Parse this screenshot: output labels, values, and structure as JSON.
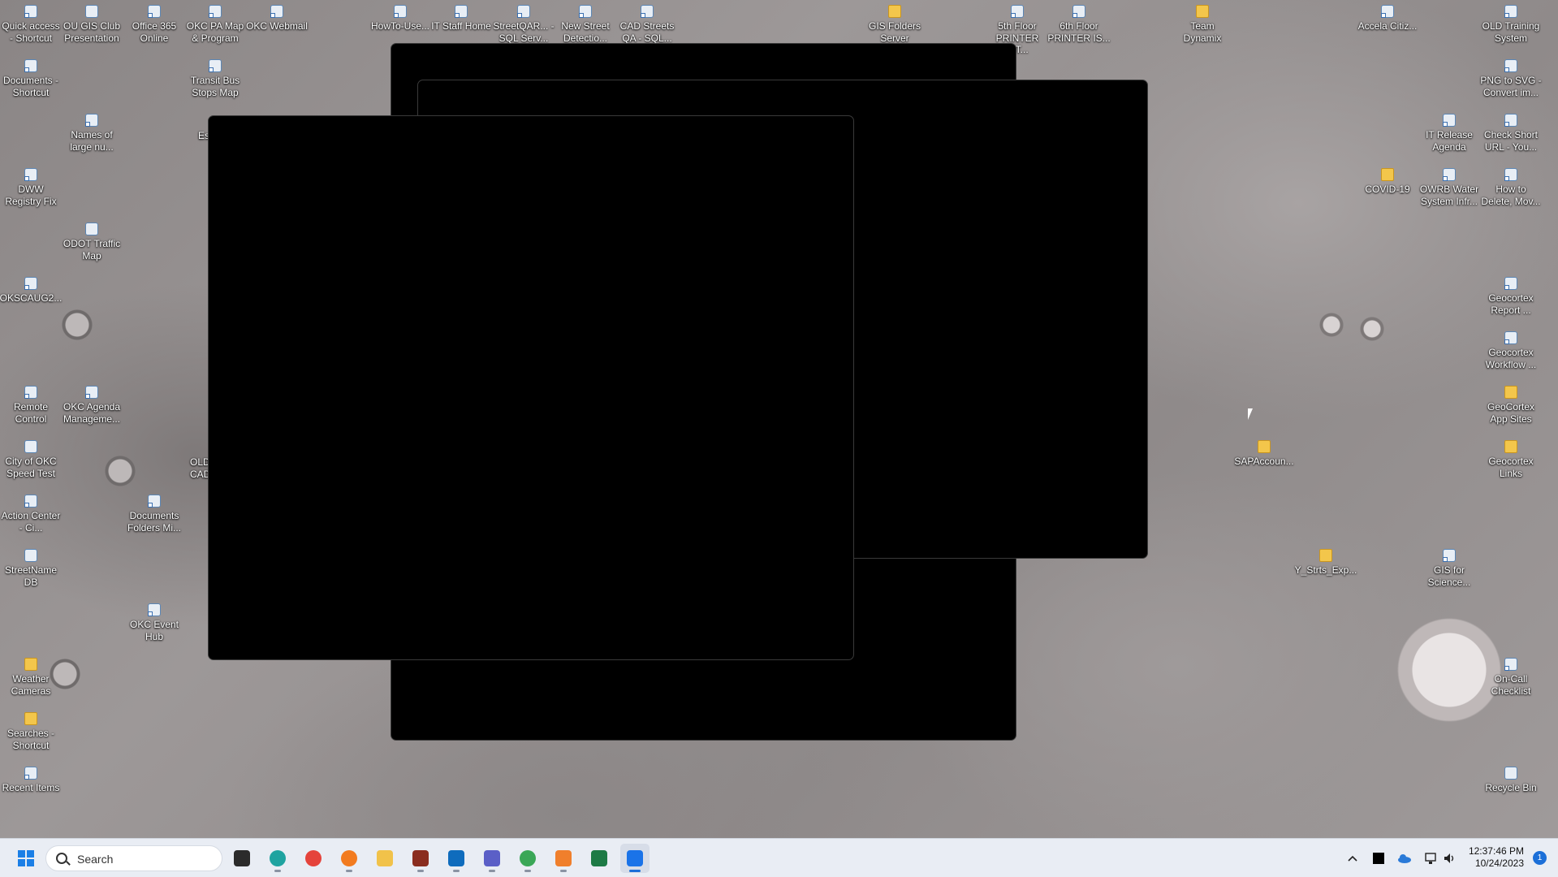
{
  "desktop": {
    "icons": [
      {
        "id": "quick-access",
        "label": "Quick access - Shortcut",
        "type": "link"
      },
      {
        "id": "ou-gis-club",
        "label": "OU GIS Club Presentation",
        "type": "doc"
      },
      {
        "id": "office-365",
        "label": "Office 365 Online",
        "type": "link"
      },
      {
        "id": "okc-pa-map",
        "label": "OKC PA Map & Program",
        "type": "link"
      },
      {
        "id": "okc-webmail",
        "label": "OKC Webmail",
        "type": "link"
      },
      {
        "id": "howto-use",
        "label": "HowTo-Use...",
        "type": "link"
      },
      {
        "id": "it-staff-home",
        "label": "IT Staff Home",
        "type": "link"
      },
      {
        "id": "streetqar",
        "label": "StreetQAR... - SQL Serv...",
        "type": "link"
      },
      {
        "id": "new-street",
        "label": "New Street Detectio...",
        "type": "link"
      },
      {
        "id": "cad-streets",
        "label": "CAD Streets QA - SQL...",
        "type": "link"
      },
      {
        "id": "gis-folders-server",
        "label": "GIS Folders Server",
        "type": "folder"
      },
      {
        "id": "5th-floor-printer",
        "label": "5th Floor PRINTER IST...",
        "type": "link"
      },
      {
        "id": "6th-floor-printer",
        "label": "6th Floor PRINTER IS...",
        "type": "link"
      },
      {
        "id": "team-dynamix",
        "label": "Team Dynamix",
        "type": "folder"
      },
      {
        "id": "accela",
        "label": "Accela Citiz...",
        "type": "link"
      },
      {
        "id": "old-training",
        "label": "OLD Training System",
        "type": "link"
      },
      {
        "id": "documents-shortcut",
        "label": "Documents - Shortcut",
        "type": "link"
      },
      {
        "id": "transit-bus",
        "label": "Transit Bus Stops Map",
        "type": "link"
      },
      {
        "id": "png-to-svg",
        "label": "PNG to SVG - Convert im...",
        "type": "link"
      },
      {
        "id": "names-large",
        "label": "Names of large nu...",
        "type": "link"
      },
      {
        "id": "it-release",
        "label": "IT Release Agenda",
        "type": "link"
      },
      {
        "id": "check-short-url",
        "label": "Check Short URL - You...",
        "type": "link"
      },
      {
        "id": "dww-registry",
        "label": "DWW Registry Fix",
        "type": "link"
      },
      {
        "id": "covid-19",
        "label": "COVID-19",
        "type": "folder"
      },
      {
        "id": "owrb-water",
        "label": "OWRB Water System Infr...",
        "type": "link"
      },
      {
        "id": "how-to-delete",
        "label": "How to Delete, Mov...",
        "type": "link"
      },
      {
        "id": "odot-traffic",
        "label": "ODOT Traffic Map",
        "type": "doc"
      },
      {
        "id": "okscaug",
        "label": "OKSCAUG2...",
        "type": "link"
      },
      {
        "id": "geocortex-report",
        "label": "Geocortex Report ...",
        "type": "link"
      },
      {
        "id": "geocortex-workflow",
        "label": "Geocortex Workflow ...",
        "type": "link"
      },
      {
        "id": "remote-control",
        "label": "Remote Control",
        "type": "link"
      },
      {
        "id": "okc-agenda",
        "label": "OKC Agenda Manageme...",
        "type": "link"
      },
      {
        "id": "geocortex-app-sites",
        "label": "GeoCortex App Sites",
        "type": "folder"
      },
      {
        "id": "sapaccoun",
        "label": "SAPAccoun...",
        "type": "folder"
      },
      {
        "id": "geocortex-links",
        "label": "Geocortex Links",
        "type": "folder"
      },
      {
        "id": "city-okc-speed",
        "label": "City of OKC Speed Test",
        "type": "doc"
      },
      {
        "id": "old-cad",
        "label": "OLD CAD",
        "type": "link"
      },
      {
        "id": "action-center",
        "label": "Action Center - Ci...",
        "type": "link"
      },
      {
        "id": "documents-folders",
        "label": "Documents Folders Mi...",
        "type": "link"
      },
      {
        "id": "streetname-db",
        "label": "StreetName DB",
        "type": "doc"
      },
      {
        "id": "y-strts-exp",
        "label": "Y_Strts_Exp...",
        "type": "folder"
      },
      {
        "id": "gis-for-science",
        "label": "GIS for Science...",
        "type": "link"
      },
      {
        "id": "okc-event-hub",
        "label": "OKC Event Hub",
        "type": "link"
      },
      {
        "id": "weather-cameras",
        "label": "Weather Cameras",
        "type": "folder"
      },
      {
        "id": "on-call-checklist",
        "label": "On-Call Checklist",
        "type": "link"
      },
      {
        "id": "searches-shortcut",
        "label": "Searches - Shortcut",
        "type": "folder"
      },
      {
        "id": "recent-items",
        "label": "Recent Items",
        "type": "link"
      },
      {
        "id": "recycle-bin",
        "label": "Recycle Bin",
        "type": "doc"
      },
      {
        "id": "partial-es",
        "label": "Es",
        "type": "link"
      }
    ]
  },
  "taskbar": {
    "search_placeholder": "Search",
    "apps": [
      {
        "name": "task-view",
        "icon": "task-view-icon",
        "color": "#2b2b2b",
        "running": false
      },
      {
        "name": "edge",
        "icon": "edge-icon",
        "color": "#1fa3a0",
        "running": true
      },
      {
        "name": "chrome",
        "icon": "chrome-icon",
        "color": "#e5433b",
        "running": false
      },
      {
        "name": "firefox",
        "icon": "firefox-icon",
        "color": "#f27b1f",
        "running": true
      },
      {
        "name": "file-explorer",
        "icon": "folder-icon",
        "color": "#f1c24a",
        "running": false
      },
      {
        "name": "arcgis-app",
        "icon": "map-app-icon",
        "color": "#8a2d1f",
        "running": true
      },
      {
        "name": "outlook",
        "icon": "outlook-icon",
        "color": "#0f6cbd",
        "running": true
      },
      {
        "name": "teams",
        "icon": "teams-icon",
        "color": "#5b5fc7",
        "running": true
      },
      {
        "name": "chrome-profile",
        "icon": "chrome-profile-icon",
        "color": "#3aa757",
        "running": true
      },
      {
        "name": "paint-app",
        "icon": "paint-icon",
        "color": "#f07f2c",
        "running": true
      },
      {
        "name": "excel",
        "icon": "excel-icon",
        "color": "#1d7a45",
        "running": false
      },
      {
        "name": "active-app",
        "icon": "gear-app-icon",
        "color": "#1a73e8",
        "running": true,
        "active": true
      }
    ],
    "clock": {
      "time": "12:37:46 PM",
      "date": "10/24/2023"
    },
    "notifications_count": "1"
  },
  "colors": {
    "taskbar_bg": "#e9edf4",
    "accent": "#1b6fd8"
  }
}
